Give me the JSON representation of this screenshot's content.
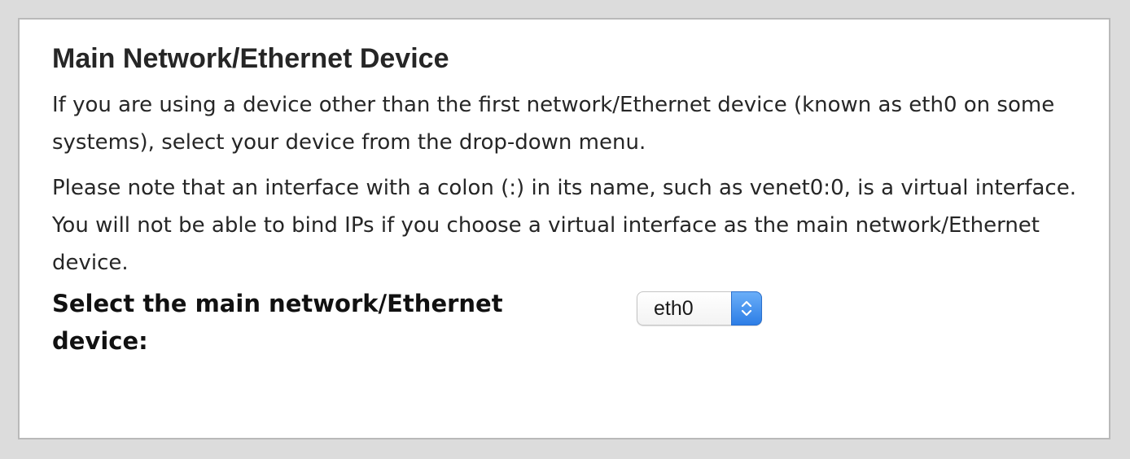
{
  "section": {
    "title": "Main Network/Ethernet Device",
    "paragraphs": [
      "If you are using a device other than the first network/Ethernet device (known as eth0 on some systems), select your device from the drop-down menu.",
      "Please note that an interface with a colon (:) in its name, such as venet0:0, is a virtual interface. You will not be able to bind IPs if you choose a virtual interface as the main network/Ethernet device."
    ],
    "select": {
      "label": "Select the main network/Ethernet device:",
      "value": "eth0",
      "icon": "chevron-up-down-icon"
    }
  },
  "colors": {
    "page_background": "#dcdcdc",
    "panel_background": "#ffffff",
    "select_accent": "#2d7ee6"
  }
}
